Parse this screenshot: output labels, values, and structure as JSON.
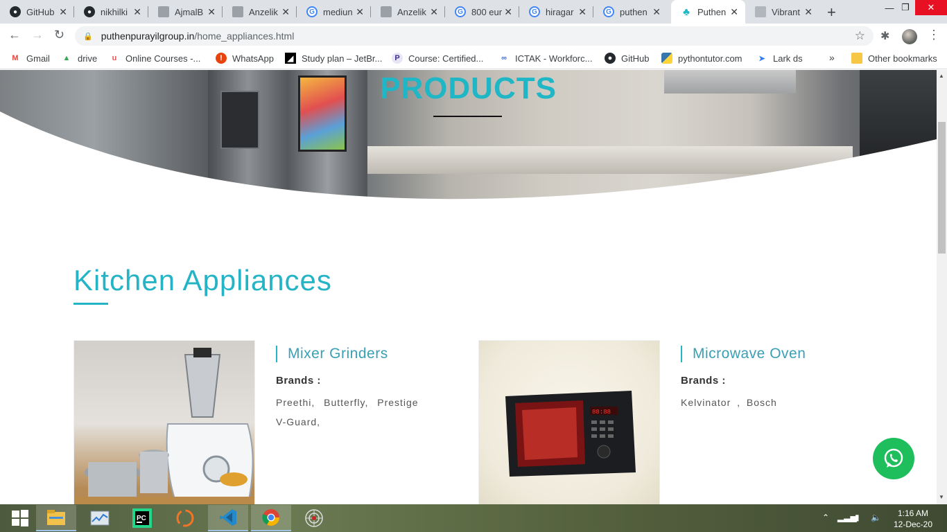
{
  "browser": {
    "tabs": [
      {
        "label": "GitHub",
        "icon": "github-icon"
      },
      {
        "label": "nikhilki",
        "icon": "github-icon"
      },
      {
        "label": "AjmalB",
        "icon": "page-icon"
      },
      {
        "label": "Anzelik",
        "icon": "page-icon"
      },
      {
        "label": "mediun",
        "icon": "google-icon"
      },
      {
        "label": "Anzelik",
        "icon": "page-icon"
      },
      {
        "label": "800 eur",
        "icon": "google-icon"
      },
      {
        "label": "hiragar",
        "icon": "google-icon"
      },
      {
        "label": "puthen",
        "icon": "google-icon"
      },
      {
        "label": "Puthen",
        "icon": "lotus-icon",
        "active": true
      },
      {
        "label": "Vibrant",
        "icon": "page-icon"
      }
    ],
    "url_host": "puthenpurayilgroup.in",
    "url_path": "/home_appliances.html",
    "bookmarks": [
      {
        "label": "Gmail",
        "icon": "gmail-icon"
      },
      {
        "label": "drive",
        "icon": "drive-icon"
      },
      {
        "label": "Online Courses -...",
        "icon": "udemy-icon"
      },
      {
        "label": "WhatsApp",
        "icon": "alert-icon"
      },
      {
        "label": "Study plan – JetBr...",
        "icon": "jetbrains-icon"
      },
      {
        "label": "Course: Certified...",
        "icon": "p-icon"
      },
      {
        "label": "ICTAK - Workforc...",
        "icon": "link-icon"
      },
      {
        "label": "GitHub",
        "icon": "github-icon"
      },
      {
        "label": "pythontutor.com",
        "icon": "python-icon"
      },
      {
        "label": "Lark ds",
        "icon": "lark-icon"
      }
    ],
    "other_bookmarks": "Other bookmarks"
  },
  "page": {
    "hero_title": "PRODUCTS",
    "section_title": "Kitchen Appliances",
    "products": [
      {
        "title": "Mixer Grinders",
        "brands_label": "Brands :",
        "brands_line1": "Preethi,   Butterfly,   Prestige",
        "brands_line2": "V-Guard,"
      },
      {
        "title": "Microwave Oven",
        "brands_label": "Brands :",
        "brands_line1": "Kelvinator   ,   Bosch"
      }
    ]
  },
  "taskbar": {
    "time": "1:16 AM",
    "date": "12-Dec-20"
  },
  "colors": {
    "accent": "#25b3c6",
    "whatsapp": "#1ebe5d"
  }
}
